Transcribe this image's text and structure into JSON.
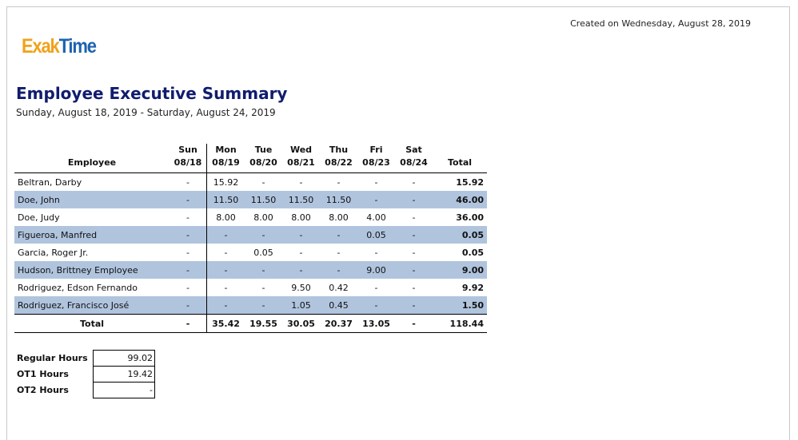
{
  "created": "Created on Wednesday, August 28, 2019",
  "logo": {
    "part1": "Exak",
    "part2": "Time"
  },
  "title": "Employee Executive Summary",
  "subtitle": "Sunday, August 18, 2019 - Saturday, August 24, 2019",
  "table": {
    "employee_header": "Employee",
    "total_header": "Total",
    "days": [
      {
        "day": "Sun",
        "date": "08/18"
      },
      {
        "day": "Mon",
        "date": "08/19"
      },
      {
        "day": "Tue",
        "date": "08/20"
      },
      {
        "day": "Wed",
        "date": "08/21"
      },
      {
        "day": "Thu",
        "date": "08/22"
      },
      {
        "day": "Fri",
        "date": "08/23"
      },
      {
        "day": "Sat",
        "date": "08/24"
      }
    ],
    "rows": [
      {
        "name": "Beltran, Darby",
        "values": [
          "-",
          "15.92",
          "-",
          "-",
          "-",
          "-",
          "-"
        ],
        "total": "15.92"
      },
      {
        "name": "Doe, John",
        "values": [
          "-",
          "11.50",
          "11.50",
          "11.50",
          "11.50",
          "-",
          "-"
        ],
        "total": "46.00"
      },
      {
        "name": "Doe, Judy",
        "values": [
          "-",
          "8.00",
          "8.00",
          "8.00",
          "8.00",
          "4.00",
          "-"
        ],
        "total": "36.00"
      },
      {
        "name": "Figueroa, Manfred",
        "values": [
          "-",
          "-",
          "-",
          "-",
          "-",
          "0.05",
          "-"
        ],
        "total": "0.05"
      },
      {
        "name": "Garcia, Roger  Jr.",
        "values": [
          "-",
          "-",
          "0.05",
          "-",
          "-",
          "-",
          "-"
        ],
        "total": "0.05"
      },
      {
        "name": "Hudson, Brittney Employee",
        "values": [
          "-",
          "-",
          "-",
          "-",
          "-",
          "9.00",
          "-"
        ],
        "total": "9.00"
      },
      {
        "name": "Rodriguez, Edson Fernando",
        "values": [
          "-",
          "-",
          "-",
          "9.50",
          "0.42",
          "-",
          "-"
        ],
        "total": "9.92"
      },
      {
        "name": "Rodriguez, Francisco José",
        "values": [
          "-",
          "-",
          "-",
          "1.05",
          "0.45",
          "-",
          "-"
        ],
        "total": "1.50"
      }
    ],
    "totals": {
      "label": "Total",
      "values": [
        "-",
        "35.42",
        "19.55",
        "30.05",
        "20.37",
        "13.05",
        "-"
      ],
      "total": "118.44"
    }
  },
  "hours": [
    {
      "label": "Regular Hours",
      "value": "99.02"
    },
    {
      "label": "OT1 Hours",
      "value": "19.42"
    },
    {
      "label": "OT2 Hours",
      "value": "-"
    }
  ],
  "colors": {
    "title": "#101c6e",
    "row_alt": "#b0c4de",
    "logo_orange": "#f2a11a",
    "logo_blue": "#1d62b0"
  }
}
